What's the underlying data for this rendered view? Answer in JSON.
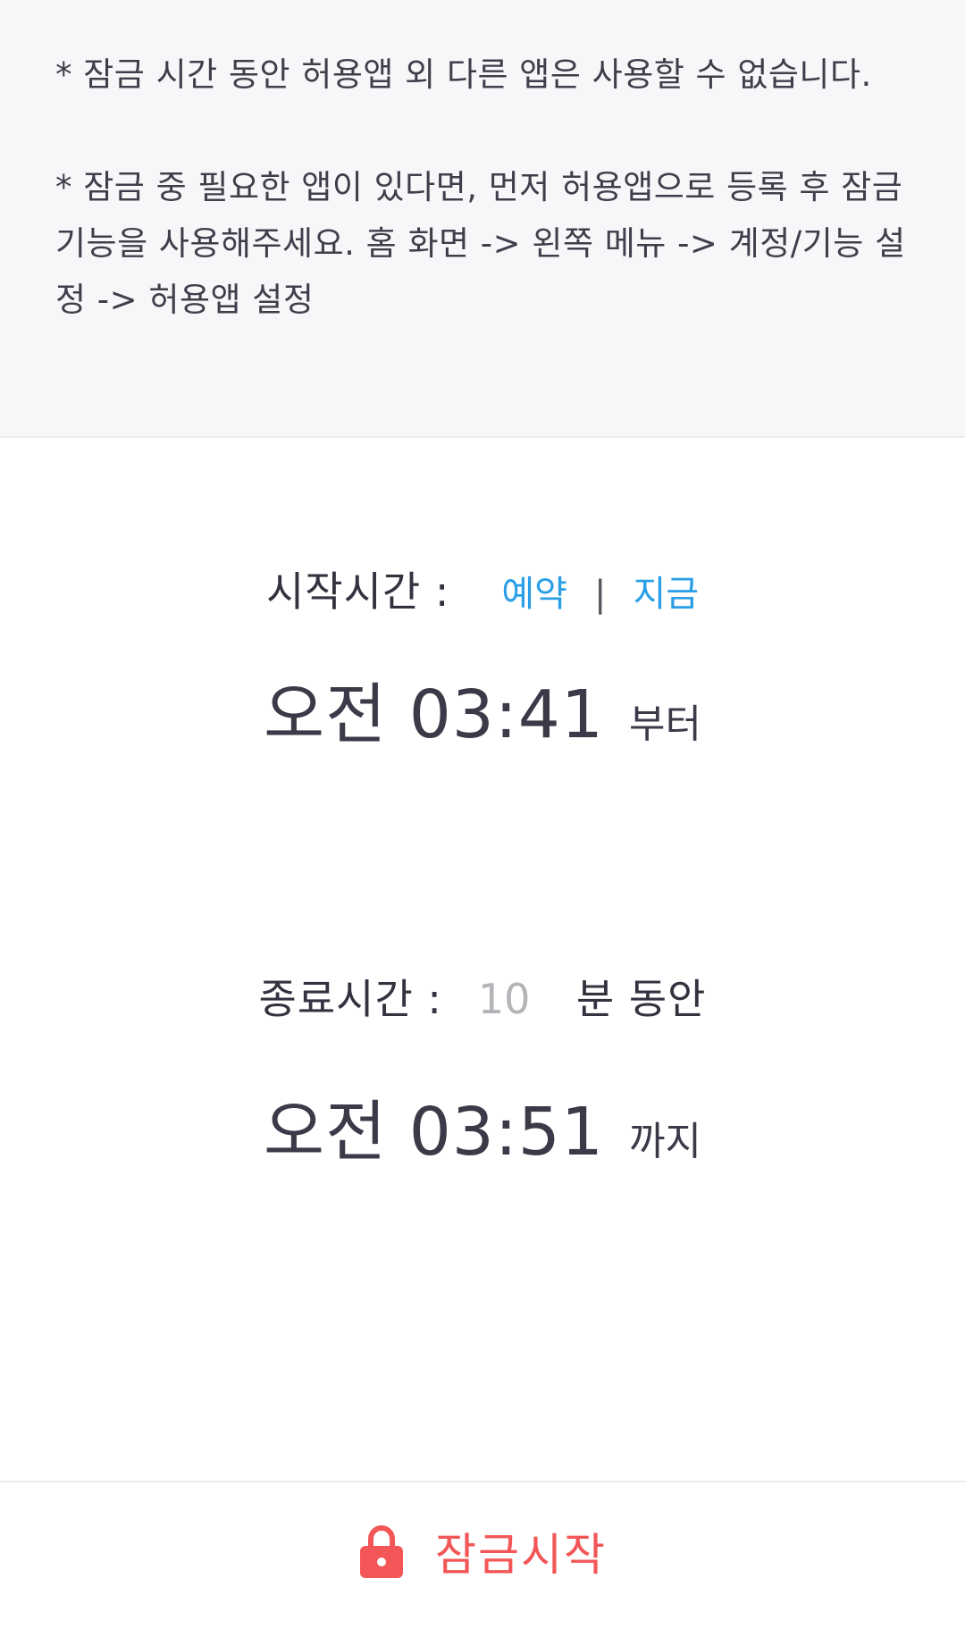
{
  "notice": {
    "line1": "* 잠금 시간 동안 허용앱 외 다른 앱은 사용할 수 없습니다.",
    "line2": "* 잠금 중 필요한 앱이 있다면, 먼저 허용앱으로 등록 후 잠금기능을 사용해주세요. 홈 화면 -> 왼쪽 메뉴 -> 계정/기능 설정 -> 허용앱 설정"
  },
  "start": {
    "label": "시작시간 :",
    "reserve_label": "예약",
    "separator": "|",
    "now_label": "지금",
    "time": "오전 03:41",
    "suffix": "부터"
  },
  "end": {
    "label": "종료시간 :",
    "minutes_placeholder": "10",
    "duration_suffix": "분 동안",
    "time": "오전 03:51",
    "suffix": "까지"
  },
  "action": {
    "icon": "lock-icon",
    "label": "잠금시작",
    "color": "#f25656"
  },
  "colors": {
    "link": "#2a9ee6",
    "notice_bg": "#f7f7f9",
    "text": "#3f3f4c",
    "placeholder": "#b3b3b8"
  }
}
